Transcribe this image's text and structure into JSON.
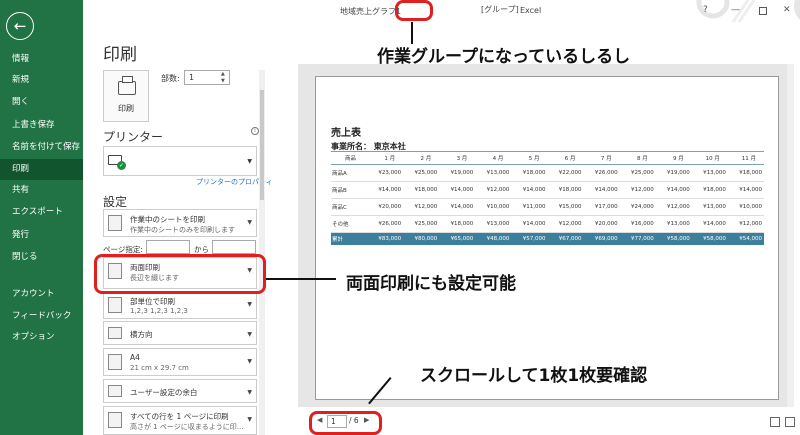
{
  "titlebar": {
    "file_name": "地域売上グラフ1",
    "group_tag": "[グループ]",
    "app_name": "Excel",
    "help": "?",
    "minimize": "—",
    "close": "✕"
  },
  "nav": {
    "back": "←",
    "items": [
      "情報",
      "新規",
      "開く",
      "上書き保存",
      "名前を付けて保存",
      "印刷",
      "共有",
      "エクスポート",
      "発行",
      "閉じる",
      "アカウント",
      "フィードバック",
      "オプション"
    ],
    "active_index": 5
  },
  "print_panel": {
    "heading": "印刷",
    "print_button": "印刷",
    "copies_label": "部数:",
    "copies_value": "1",
    "printer_heading": "プリンター",
    "printer_properties": "プリンターのプロパティ",
    "settings_heading": "設定",
    "settings": [
      {
        "line1": "作業中のシートを印刷",
        "line2": "作業中のシートのみを印刷します"
      },
      {
        "line1": "両面印刷",
        "line2": "長辺を綴じます"
      },
      {
        "line1": "部単位で印刷",
        "line2": "1,2,3    1,2,3    1,2,3"
      },
      {
        "line1": "横方向",
        "line2": ""
      },
      {
        "line1": "A4",
        "line2": "21 cm x 29.7 cm"
      },
      {
        "line1": "ユーザー設定の余白",
        "line2": ""
      },
      {
        "line1": "すべての行を 1 ページに印刷",
        "line2": "高さが 1 ページに収まるように印..."
      }
    ],
    "pages_label": "ページ指定:",
    "pages_to": "から"
  },
  "preview": {
    "sheet_title": "売上表",
    "office_label": "事業所名：  東京本社",
    "table": {
      "headers": [
        "商品",
        "1 月",
        "2 月",
        "3 月",
        "4 月",
        "5 月",
        "6 月",
        "7 月",
        "8 月",
        "9 月",
        "10 月",
        "11 月"
      ],
      "rows": [
        [
          "商品A",
          "¥23,000",
          "¥25,000",
          "¥19,000",
          "¥13,000",
          "¥18,000",
          "¥22,000",
          "¥26,000",
          "¥25,000",
          "¥19,000",
          "¥13,000",
          "¥18,000"
        ],
        [
          "商品B",
          "¥14,000",
          "¥18,000",
          "¥14,000",
          "¥12,000",
          "¥14,000",
          "¥18,000",
          "¥14,000",
          "¥12,000",
          "¥14,000",
          "¥18,000",
          "¥14,000"
        ],
        [
          "商品C",
          "¥20,000",
          "¥12,000",
          "¥14,000",
          "¥10,000",
          "¥11,000",
          "¥15,000",
          "¥17,000",
          "¥24,000",
          "¥12,000",
          "¥13,000",
          "¥10,000"
        ],
        [
          "その他",
          "¥26,000",
          "¥25,000",
          "¥18,000",
          "¥13,000",
          "¥14,000",
          "¥12,000",
          "¥20,000",
          "¥16,000",
          "¥13,000",
          "¥14,000",
          "¥12,000"
        ]
      ],
      "total": [
        "累計",
        "¥83,000",
        "¥80,000",
        "¥65,000",
        "¥48,000",
        "¥57,000",
        "¥67,000",
        "¥69,000",
        "¥77,000",
        "¥58,000",
        "¥58,000",
        "¥54,000"
      ]
    },
    "pager": {
      "prev": "◀",
      "current_page": "1",
      "total": "/ 6",
      "next": "▶"
    }
  },
  "annotations": {
    "group_note": "作業グループになっているしるし",
    "duplex_note": "両面印刷にも設定可能",
    "scroll_note": "スクロールして1枚1枚要確認"
  },
  "colors": {
    "nav_green": "#217346",
    "nav_active": "#10552e",
    "annotation_red": "#e02020",
    "table_total": "#3c7f9c"
  }
}
